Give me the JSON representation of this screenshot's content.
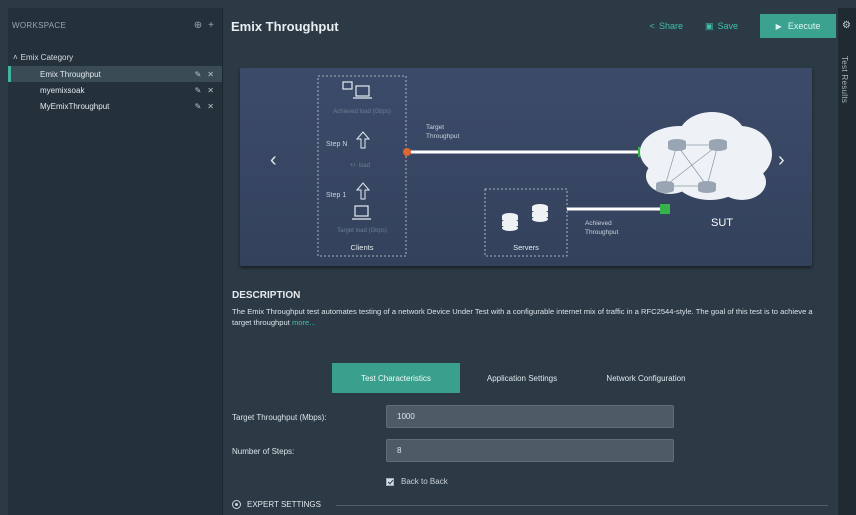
{
  "sidebar": {
    "title": "WORKSPACE",
    "category": "Emix Category",
    "items": [
      {
        "label": "Emix Throughput",
        "active": true
      },
      {
        "label": "myemixsoak",
        "active": false
      },
      {
        "label": "MyEmixThroughput",
        "active": false
      }
    ]
  },
  "header": {
    "title": "Emix Throughput",
    "share_label": "Share",
    "save_label": "Save",
    "execute_label": "Execute"
  },
  "right_panel": {
    "label": "Test Results"
  },
  "diagram": {
    "clients_label": "Clients",
    "servers_label": "Servers",
    "sut_label": "SUT",
    "step_n": "Step N",
    "step_1": "Step 1",
    "achieved_load": "Achieved load (Gbps)",
    "target_load": "Target load (Gbps)",
    "load_delta": "+/- load",
    "target_throughput_line1": "Target",
    "target_throughput_line2": "Throughput",
    "achieved_throughput_line1": "Achieved",
    "achieved_throughput_line2": "Throughput",
    "colors": {
      "target_marker": "#e0662f",
      "port_green": "#36b34a",
      "line": "#ffffff"
    }
  },
  "description": {
    "title": "DESCRIPTION",
    "text": "The Emix Throughput test automates testing of a network Device Under Test with a configurable internet mix of traffic in a RFC2544-style. The goal of this test is to achieve a target throughput",
    "more": "more..."
  },
  "tabs": [
    {
      "label": "Test Characteristics",
      "active": true
    },
    {
      "label": "Application Settings",
      "active": false
    },
    {
      "label": "Network Configuration",
      "active": false
    }
  ],
  "form": {
    "target_throughput_label": "Target Throughput (Mbps):",
    "target_throughput_value": "1000",
    "steps_label": "Number of Steps:",
    "steps_value": "8",
    "back_to_back_label": "Back to Back",
    "back_to_back_checked": true
  },
  "expert_settings": "EXPERT SETTINGS",
  "colors": {
    "accent": "#3fc0a8",
    "tab_active": "#3a9f8d",
    "execute": "#3aa28f"
  }
}
